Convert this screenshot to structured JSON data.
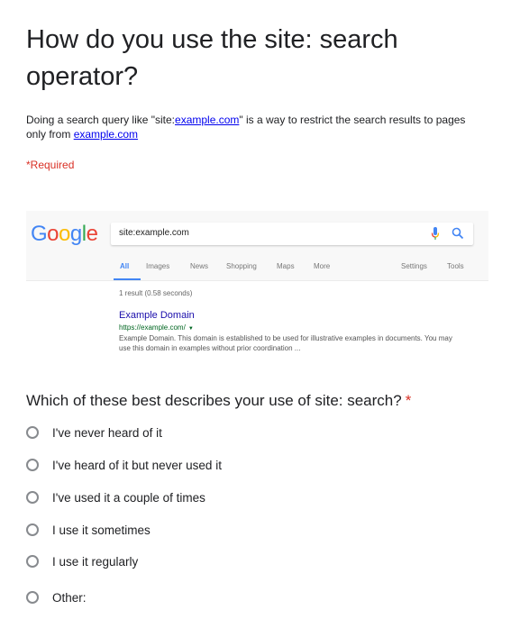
{
  "form": {
    "title": "How do you use the site: search operator?",
    "description_prefix": "Doing a search query like \"site:",
    "description_link1": "example.com",
    "description_middle": "\" is a way to restrict the search results to pages only from ",
    "description_link2": "example.com",
    "required_note": "*Required"
  },
  "embedded_screenshot": {
    "logo_letters": [
      {
        "char": "G",
        "color": "#4285f4"
      },
      {
        "char": "o",
        "color": "#ea4335"
      },
      {
        "char": "o",
        "color": "#fbbc05"
      },
      {
        "char": "g",
        "color": "#4285f4"
      },
      {
        "char": "l",
        "color": "#34a853"
      },
      {
        "char": "e",
        "color": "#ea4335"
      }
    ],
    "search_query": "site:example.com",
    "tabs": [
      "All",
      "Images",
      "News",
      "Shopping",
      "Maps",
      "More",
      "Settings",
      "Tools"
    ],
    "active_tab": "All",
    "result_stats": "1 result (0.58 seconds)",
    "result": {
      "title": "Example Domain",
      "url": "https://example.com/",
      "snippet": "Example Domain. This domain is established to be used for illustrative examples in documents. You may use this domain in examples without prior coordination ..."
    }
  },
  "question": {
    "title": "Which of these best describes your use of site: search?",
    "required_marker": "*",
    "options": [
      {
        "label": "I've never heard of it",
        "selected": false
      },
      {
        "label": "I've heard of it but never used it",
        "selected": false
      },
      {
        "label": "I've used it a couple of times",
        "selected": false
      },
      {
        "label": "I use it sometimes",
        "selected": false
      },
      {
        "label": "I use it regularly",
        "selected": false
      },
      {
        "label": "Other:",
        "selected": false
      }
    ]
  }
}
